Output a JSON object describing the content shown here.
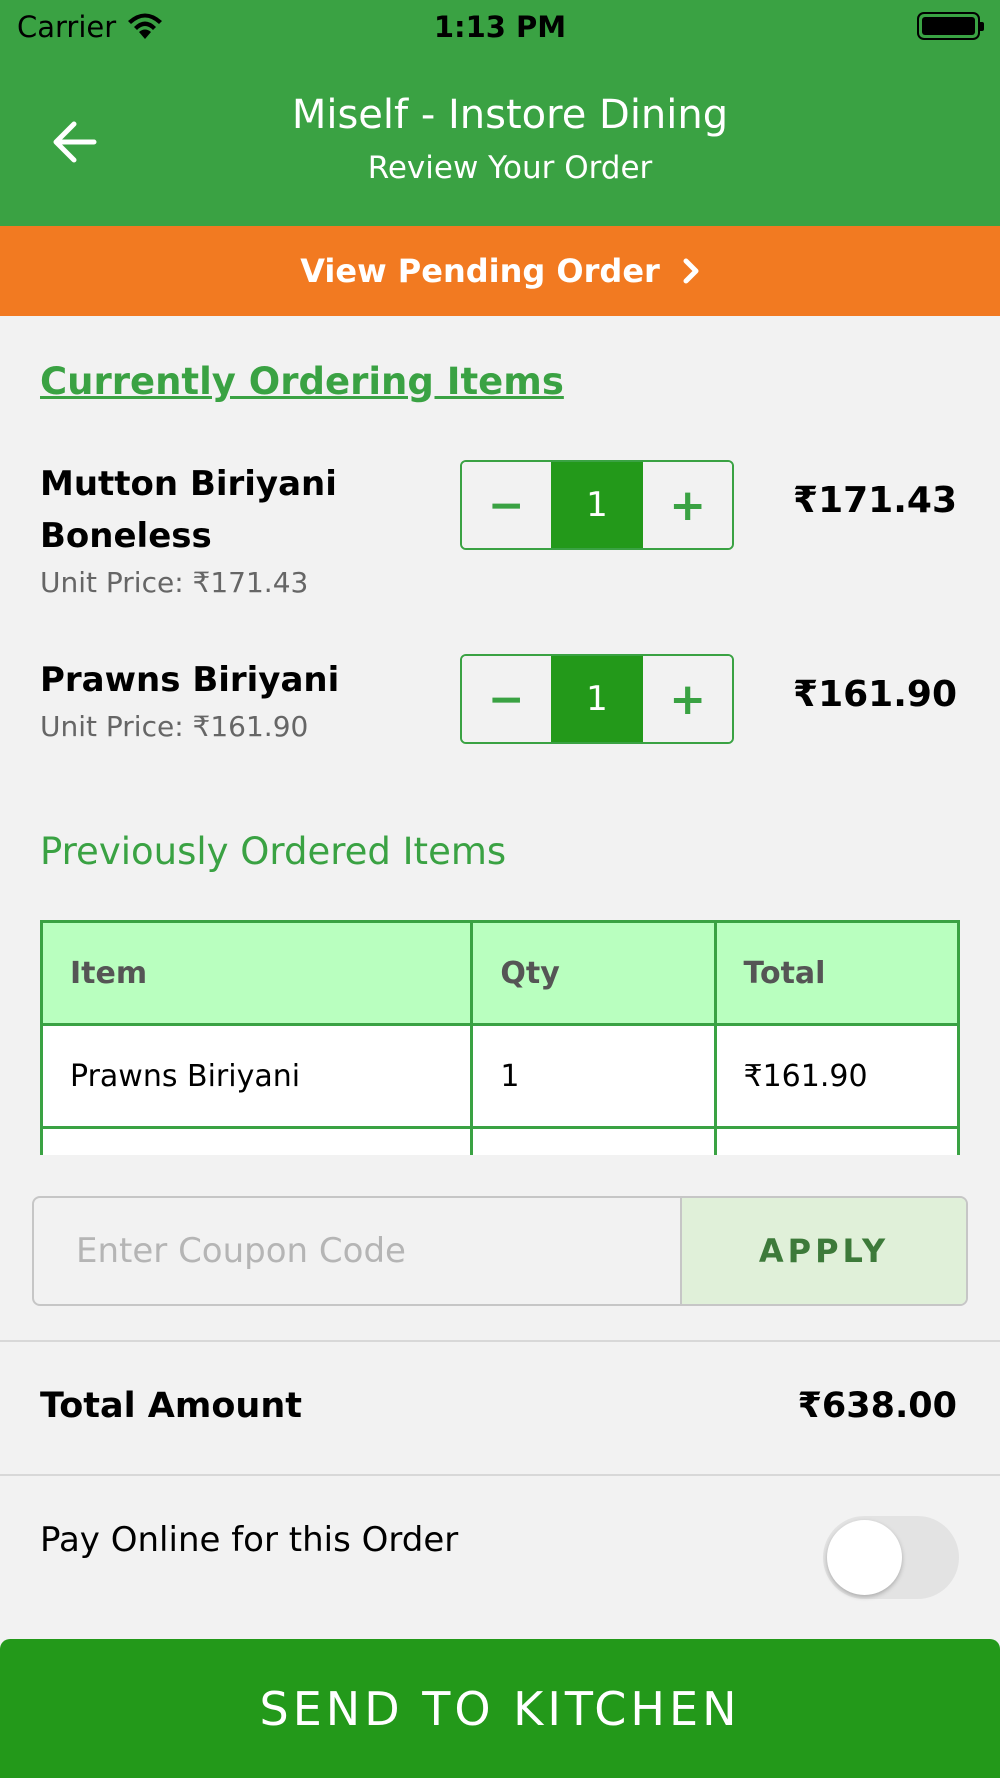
{
  "status_bar": {
    "carrier": "Carrier",
    "time": "1:13 PM"
  },
  "header": {
    "title": "Miself - Instore Dining",
    "subtitle": "Review Your Order"
  },
  "pending": {
    "label": "View Pending Order"
  },
  "current_section": {
    "heading": "Currently Ordering Items",
    "items": [
      {
        "name": "Mutton Biriyani Boneless",
        "unit_price": "Unit Price: ₹171.43",
        "qty": "1",
        "total": "₹171.43"
      },
      {
        "name": "Prawns Biriyani",
        "unit_price": "Unit Price: ₹161.90",
        "qty": "1",
        "total": "₹161.90"
      }
    ],
    "minus": "−",
    "plus": "+"
  },
  "previous_section": {
    "heading": "Previously Ordered Items",
    "columns": [
      "Item",
      "Qty",
      "Total"
    ],
    "rows": [
      [
        "Prawns Biriyani",
        "1",
        "₹161.90"
      ],
      [
        "",
        "",
        ""
      ]
    ]
  },
  "coupon": {
    "placeholder": "Enter Coupon Code",
    "apply_label": "APPLY"
  },
  "total": {
    "label": "Total Amount",
    "value": "₹638.00"
  },
  "pay_online": {
    "label": "Pay Online for this Order",
    "enabled": false
  },
  "send_button": {
    "label": "SEND TO KITCHEN"
  },
  "colors": {
    "header_green": "#3aa243",
    "pending_orange": "#f27a21",
    "button_green": "#23991a",
    "table_header": "#b9ffbf"
  }
}
